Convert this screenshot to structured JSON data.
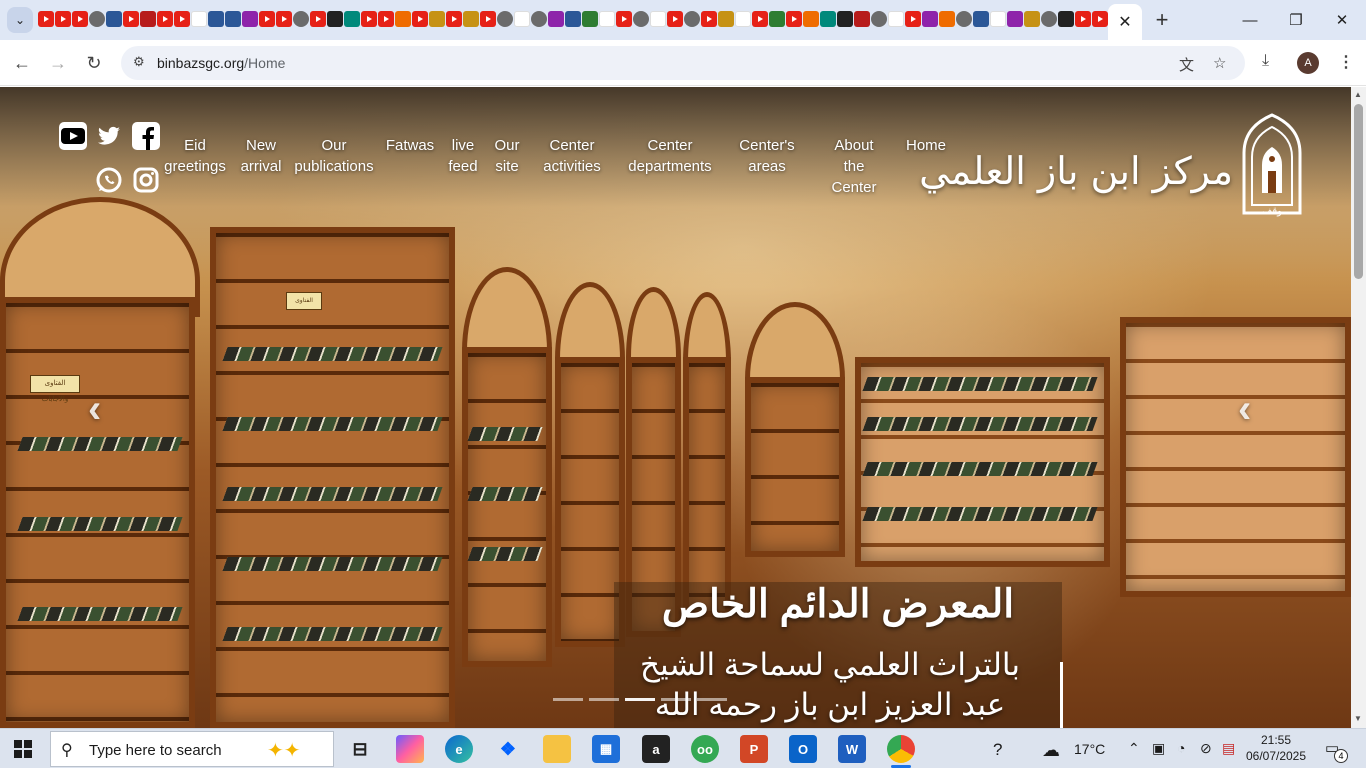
{
  "browser": {
    "url_host": "binbazsgc.org",
    "url_path": "/Home",
    "active_tab_close": "✕",
    "new_tab": "+",
    "profile_initial": "A"
  },
  "site": {
    "logo_text": "مركز ابن باز العلمي",
    "logo_sub": "وقف",
    "nav": [
      {
        "label": "Eid greetings"
      },
      {
        "label": "New arrival"
      },
      {
        "label": "Our publications"
      },
      {
        "label": "Fatwas"
      },
      {
        "label": "live feed"
      },
      {
        "label": "Our site"
      },
      {
        "label": "Center activities"
      },
      {
        "label": "Center departments"
      },
      {
        "label": "Center's areas"
      },
      {
        "label": "About the Center"
      },
      {
        "label": "Home"
      }
    ],
    "social_icons": [
      "youtube-icon",
      "twitter-icon",
      "facebook-icon",
      "whatsapp-icon",
      "instagram-icon"
    ],
    "hero": {
      "title": "المعرض الدائم الخاص",
      "line1": "بالتراث العلمي لسماحة الشيخ",
      "line2": "عبد العزيز ابن باز رحمه الله",
      "slide_count": 5,
      "active_slide": 2
    },
    "shelf_signs": [
      "الفتاوى والإجابات",
      "الفتاوى والاجابات"
    ]
  },
  "taskbar": {
    "search_placeholder": "Type here to search",
    "temperature": "17°C",
    "time": "21:55",
    "date": "06/07/2025",
    "notification_count": "4"
  },
  "colors": {
    "accent": "#1a73e8",
    "wood_dark": "#7a3c12",
    "youtube_red": "#e62117"
  }
}
